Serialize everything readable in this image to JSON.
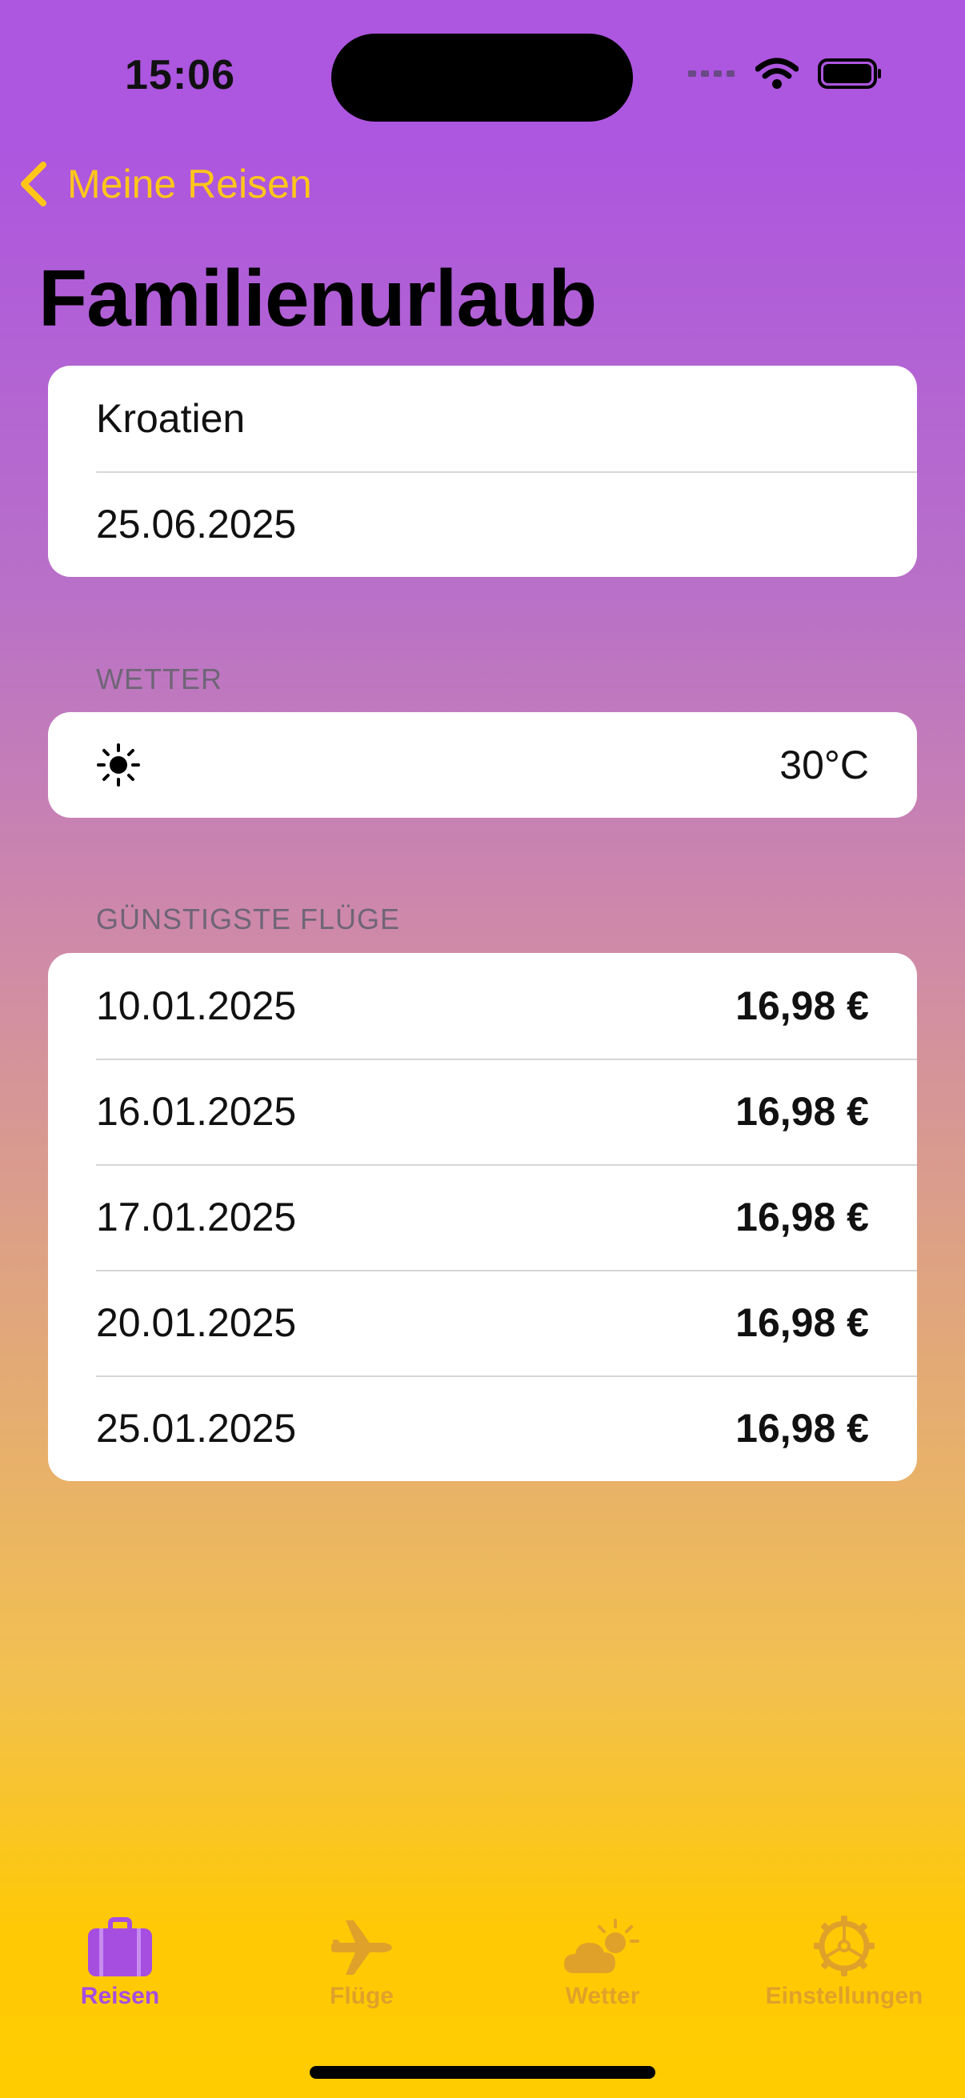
{
  "status": {
    "time": "15:06"
  },
  "nav": {
    "back_label": "Meine Reisen"
  },
  "page": {
    "title": "Familienurlaub"
  },
  "trip": {
    "destination": "Kroatien",
    "date": "25.06.2025"
  },
  "weather": {
    "header": "WETTER",
    "temperature": "30°C",
    "icon": "sun-icon"
  },
  "flights": {
    "header": "GÜNSTIGSTE FLÜGE",
    "rows": [
      {
        "date": "10.01.2025",
        "price": "16,98 €"
      },
      {
        "date": "16.01.2025",
        "price": "16,98 €"
      },
      {
        "date": "17.01.2025",
        "price": "16,98 €"
      },
      {
        "date": "20.01.2025",
        "price": "16,98 €"
      },
      {
        "date": "25.01.2025",
        "price": "16,98 €"
      }
    ]
  },
  "tabs": [
    {
      "label": "Reisen",
      "icon": "suitcase-icon",
      "active": true
    },
    {
      "label": "Flüge",
      "icon": "airplane-icon",
      "active": false
    },
    {
      "label": "Wetter",
      "icon": "cloud-sun-icon",
      "active": false
    },
    {
      "label": "Einstellungen",
      "icon": "gear-icon",
      "active": false
    }
  ],
  "colors": {
    "accent": "#ffc61a",
    "active_tab": "#a54ee0",
    "inactive_tab": "#e0a12a"
  }
}
